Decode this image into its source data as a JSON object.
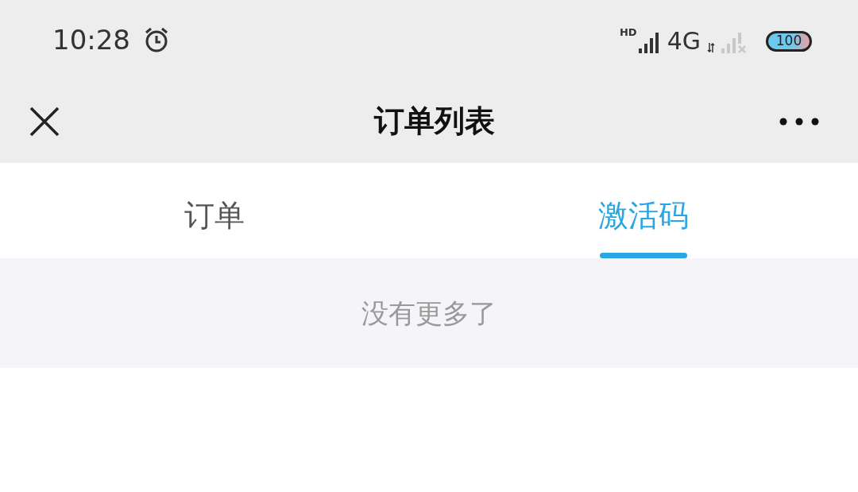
{
  "status_bar": {
    "time": "10:28",
    "hd": "HD",
    "network": "4G",
    "battery": "100"
  },
  "nav": {
    "title": "订单列表"
  },
  "tabs": [
    {
      "label": "订单",
      "selected": false
    },
    {
      "label": "激活码",
      "selected": true
    }
  ],
  "list_end": "没有更多了"
}
